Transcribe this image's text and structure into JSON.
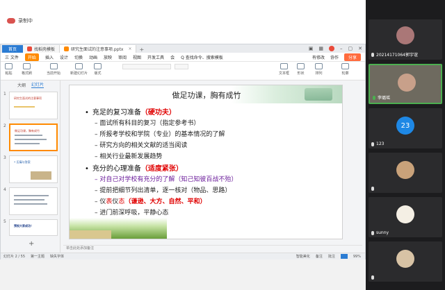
{
  "recording": {
    "label": "录制中"
  },
  "tabs": [
    {
      "label": "首页",
      "kind": "home"
    },
    {
      "label": "找稻壳模板",
      "kind": "doc"
    },
    {
      "label": "研究生面试的注意事项.pptx",
      "kind": "doc-active"
    }
  ],
  "menu": {
    "file": "三 文件",
    "start": "开始",
    "items": [
      "插入",
      "设计",
      "切换",
      "动画",
      "放映",
      "审阅",
      "视图",
      "开发工具",
      "会"
    ],
    "search": "Q 查找命令、搜索模板",
    "right": [
      "有修改",
      "协作",
      "分享"
    ]
  },
  "toolbar": {
    "items": [
      "粘贴",
      "格式刷",
      "当前开始",
      "新建幻灯片",
      "版式",
      "节",
      "重置",
      "文本框",
      "形状",
      "排列",
      "轮廓"
    ]
  },
  "panel": {
    "tabs": [
      "大纲",
      "幻灯片"
    ],
    "slides": [
      {
        "num": "1",
        "title": "研究生面试的注意事项"
      },
      {
        "num": "2",
        "title": "做足功课，胸有成竹"
      },
      {
        "num": "3",
        "title": "• 压痛与答案"
      },
      {
        "num": "4",
        "title": ""
      },
      {
        "num": "5",
        "title": "预祝大家成功！"
      }
    ],
    "add": "+"
  },
  "slide": {
    "title": "做足功课，胸有成竹",
    "section1": {
      "prefix": "充足的复习准备",
      "emph": "（硬功夫）"
    },
    "section1_items": [
      "面试所有科目的复习（指定参考书）",
      "所报考学校和学院（专业）的基本情况的了解",
      "研究方向的相关文献的适当阅读",
      "相关行业最新发展趋势"
    ],
    "section2": {
      "prefix": "充分的心理准备",
      "emph": "（适度紧张）"
    },
    "section2_item1": "对自己对学校有充分的了解（知己知彼百战不殆）",
    "section2_item2": "提前把细节列出清单，逐一核对（物品、思路）",
    "section2_item3": {
      "a": "仪",
      "b": "表",
      "c": "仪",
      "d": "态",
      "e": "（谦逊、大方、自然、平和）"
    },
    "section2_item4": "进门前深呼吸，平静心态"
  },
  "notes": {
    "placeholder": "单击此处添加备注"
  },
  "status": {
    "slide_count": "幻灯片 2 / 55",
    "theme": "第一主题",
    "font_missing": "缺失字体",
    "notes_toggle": "智能美化",
    "notes": "备注",
    "comments": "批注",
    "zoom": "99%"
  },
  "participants": [
    {
      "name": "20214171064郭宇谊",
      "mic": "on"
    },
    {
      "name": "李璐瑶",
      "mic": "on",
      "active": true
    },
    {
      "name": "123",
      "avatar_text": "23",
      "avatar_color": "#1e88e5"
    },
    {
      "name": "",
      "avatar_text": ""
    },
    {
      "name": "sunny",
      "avatar_text": ""
    },
    {
      "name": "",
      "avatar_text": ""
    }
  ]
}
